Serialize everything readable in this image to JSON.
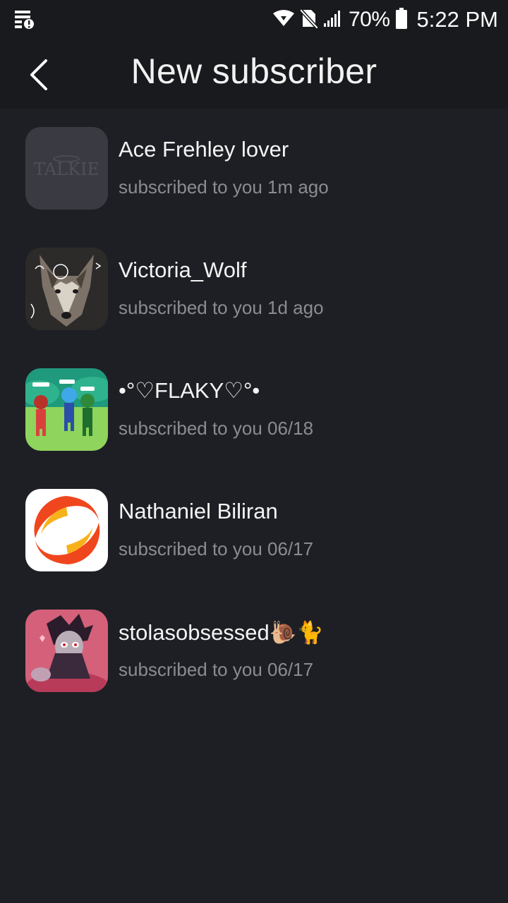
{
  "status_bar": {
    "battery": "70%",
    "time": "5:22 PM",
    "icons": [
      "notification-icon",
      "wifi-icon",
      "no-sim-icon",
      "signal-icon",
      "battery-icon"
    ]
  },
  "header": {
    "title": "New subscriber",
    "back_icon": "chevron-left-icon"
  },
  "subscribers": [
    {
      "name": "Ace Frehley lover",
      "subtitle": "subscribed to you 1m ago",
      "avatar_text": "TALKIE"
    },
    {
      "name": "Victoria_Wolf",
      "subtitle": "subscribed to you 1d ago"
    },
    {
      "name": "•°♡FLAKY♡°•",
      "subtitle": "subscribed to you 06/18"
    },
    {
      "name": "Nathaniel Biliran",
      "subtitle": "subscribed to you 06/17"
    },
    {
      "name": "stolasobsessed🐌🐈",
      "subtitle": "subscribed to you 06/17"
    }
  ],
  "colors": {
    "background": "#1e1f24",
    "bar": "#191a1e",
    "secondary_text": "#8b8c91"
  }
}
